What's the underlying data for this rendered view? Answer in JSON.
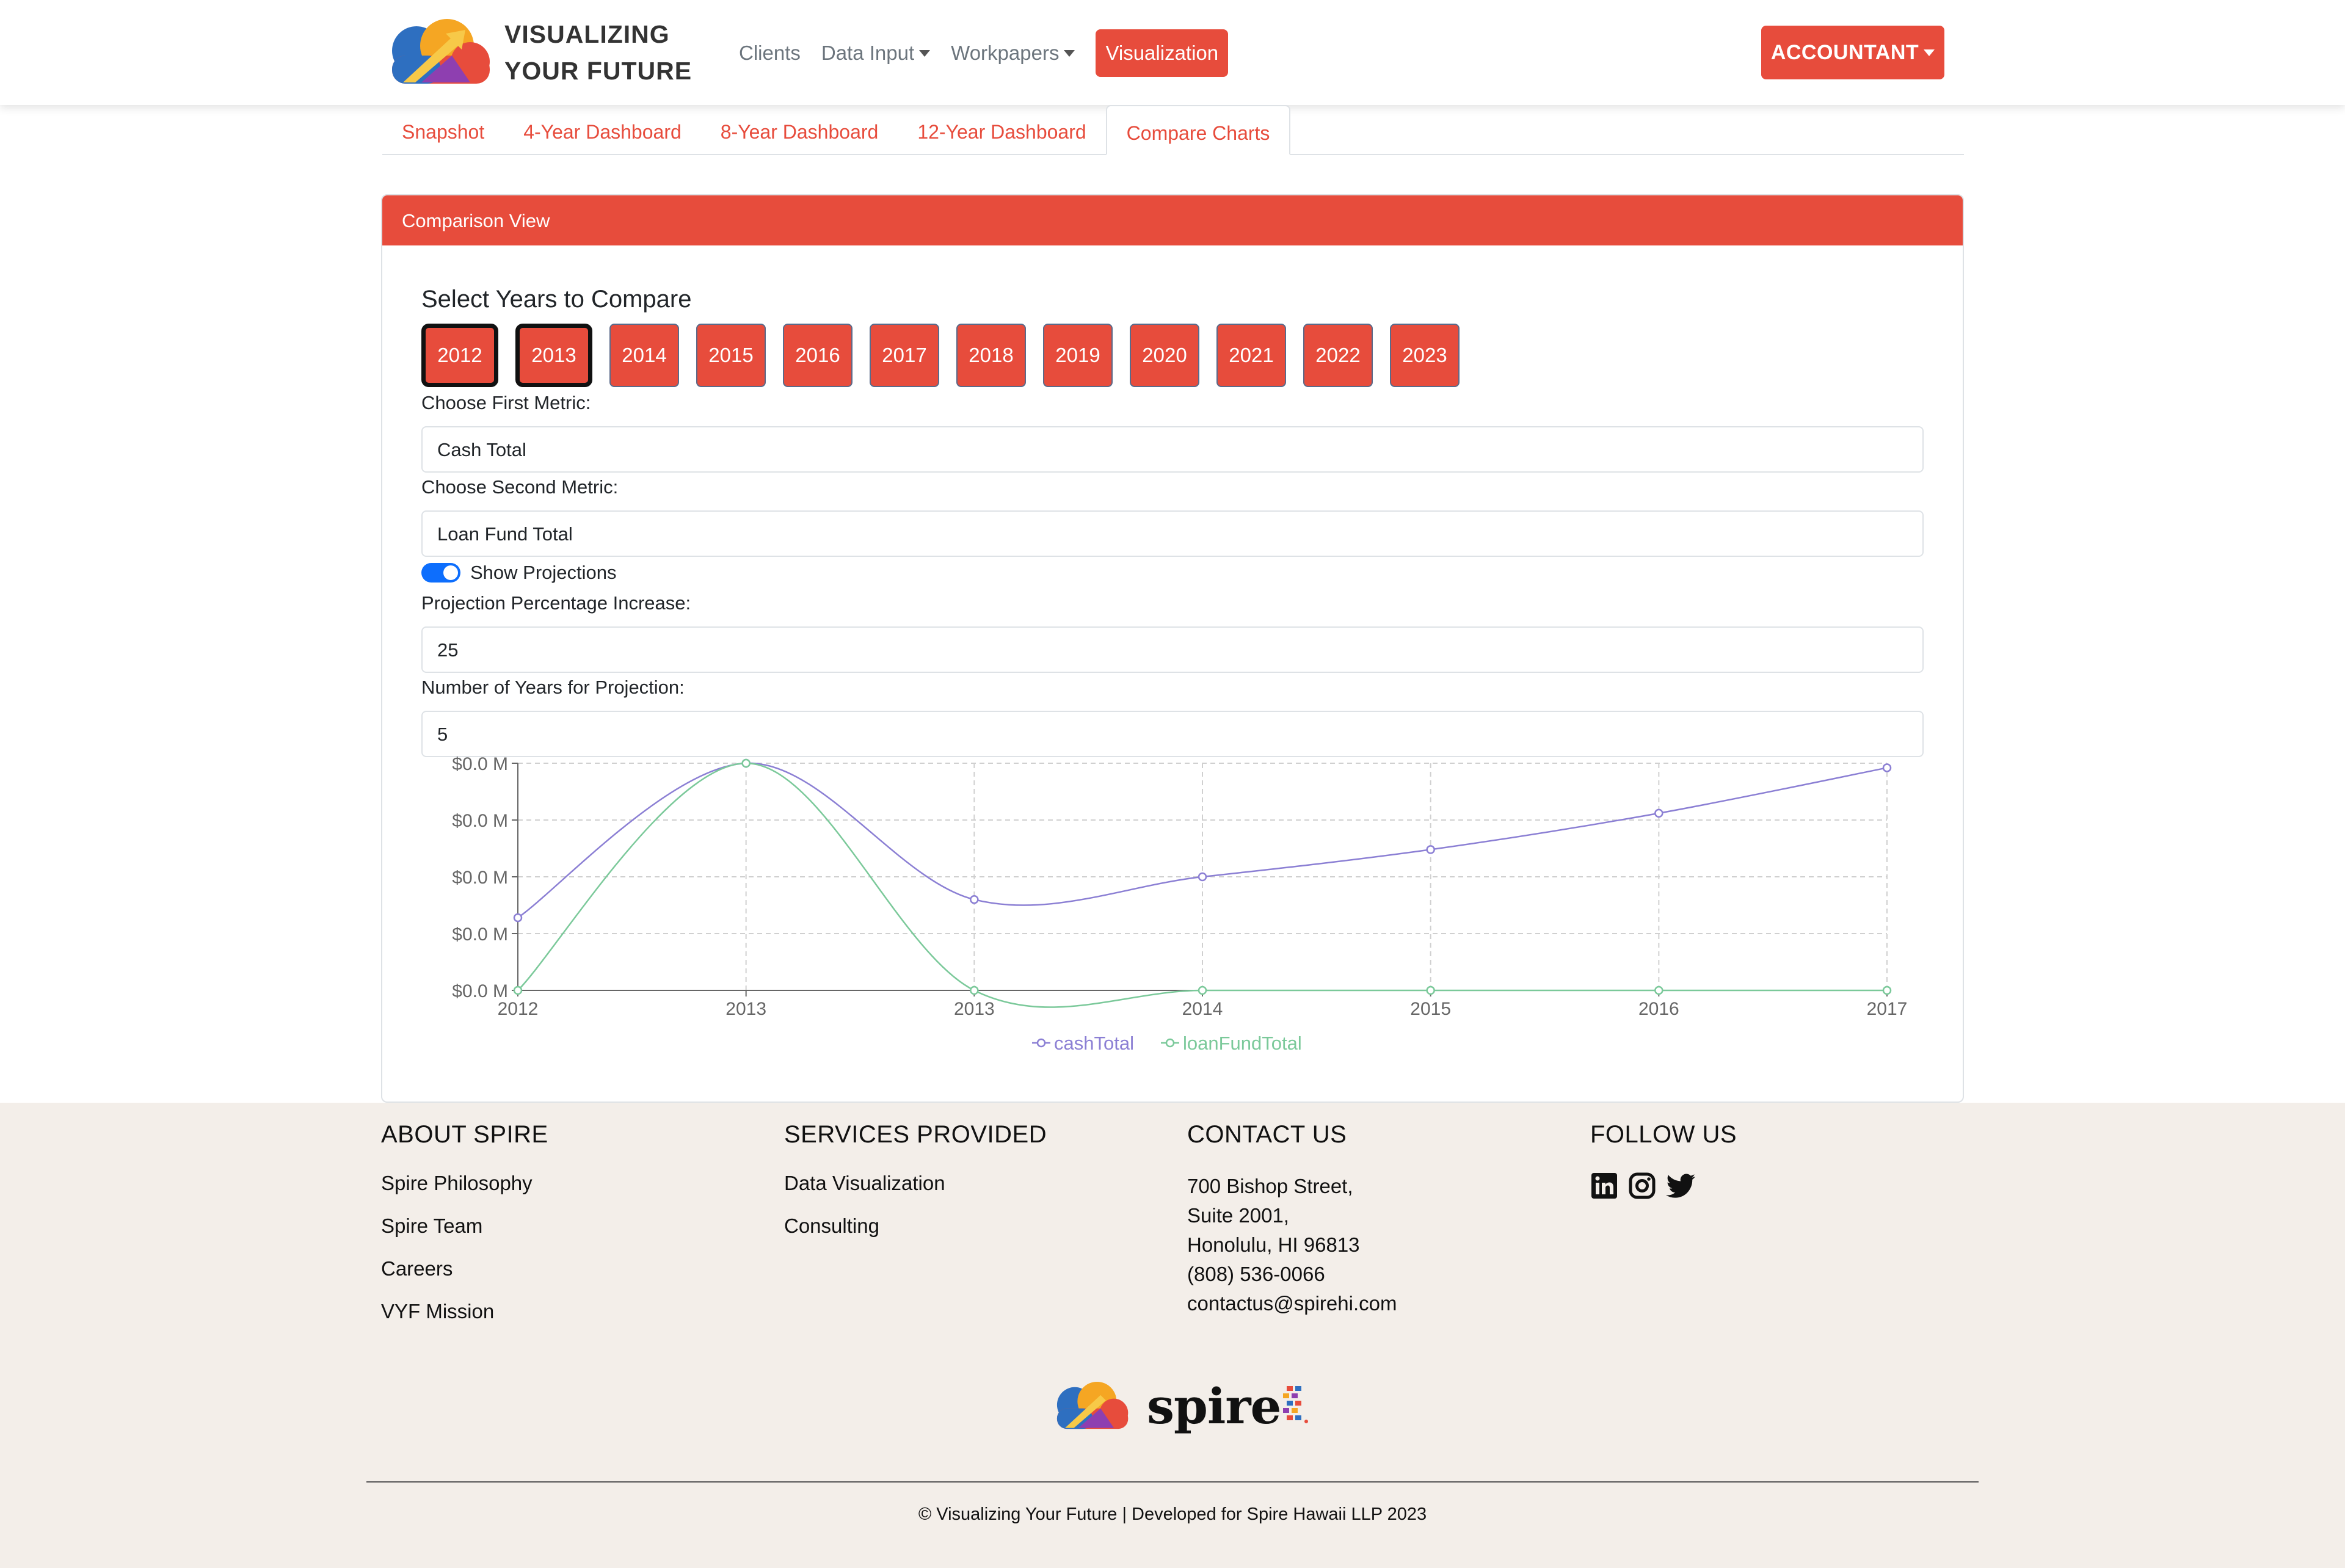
{
  "brand": {
    "line1": "VISUALIZING",
    "line2": "YOUR FUTURE"
  },
  "nav": {
    "clients": "Clients",
    "data_input": "Data Input",
    "workpapers": "Workpapers",
    "visualization": "Visualization",
    "account": "ACCOUNTANT"
  },
  "tabs": [
    {
      "label": "Snapshot"
    },
    {
      "label": "4-Year Dashboard"
    },
    {
      "label": "8-Year Dashboard"
    },
    {
      "label": "12-Year Dashboard"
    },
    {
      "label": "Compare Charts",
      "active": true
    }
  ],
  "card": {
    "header": "Comparison View",
    "years_title": "Select Years to Compare",
    "years": [
      "2012",
      "2013",
      "2014",
      "2015",
      "2016",
      "2017",
      "2018",
      "2019",
      "2020",
      "2021",
      "2022",
      "2023"
    ],
    "selected_years": [
      "2012",
      "2013"
    ],
    "first_metric_label": "Choose First Metric:",
    "first_metric_value": "Cash Total",
    "second_metric_label": "Choose Second Metric:",
    "second_metric_value": "Loan Fund Total",
    "show_projections_label": "Show Projections",
    "show_projections": true,
    "projection_pct_label": "Projection Percentage Increase:",
    "projection_pct_value": "25",
    "projection_years_label": "Number of Years for Projection:",
    "projection_years_value": "5"
  },
  "chart_data": {
    "type": "line",
    "x": [
      "2012",
      "2013",
      "2013",
      "2014",
      "2015",
      "2016",
      "2017"
    ],
    "y_tick_labels": [
      "$0.0 M",
      "$0.0 M",
      "$0.0 M",
      "$0.0 M",
      "$0.0 M"
    ],
    "ylim": [
      0,
      1
    ],
    "grid": true,
    "legend_position": "bottom",
    "series": [
      {
        "name": "cashTotal",
        "color": "#8b7fd4",
        "values": [
          0.32,
          1.0,
          0.4,
          0.5,
          0.62,
          0.78,
          0.98
        ]
      },
      {
        "name": "loanFundTotal",
        "color": "#7bc99a",
        "values": [
          0.0,
          1.0,
          0.0,
          0.0,
          0.0,
          0.0,
          0.0
        ]
      }
    ]
  },
  "footer": {
    "about_title": "ABOUT SPIRE",
    "about_links": [
      "Spire Philosophy",
      "Spire Team",
      "Careers",
      "VYF Mission"
    ],
    "services_title": "SERVICES PROVIDED",
    "services_links": [
      "Data Visualization",
      "Consulting"
    ],
    "contact_title": "CONTACT US",
    "contact_lines": [
      "700 Bishop Street,",
      "Suite 2001,",
      "Honolulu, HI 96813",
      "(808) 536-0066",
      "contactus@spirehi.com"
    ],
    "follow_title": "FOLLOW US",
    "social_icons": [
      "linkedin-icon",
      "instagram-icon",
      "twitter-icon"
    ],
    "logo_word": "spire",
    "copyright": "© Visualizing Your Future | Developed for Spire Hawaii LLP 2023"
  },
  "colors": {
    "accent": "#e74c3c",
    "toggle": "#0d6efd",
    "footer_bg": "#f3eee9"
  }
}
